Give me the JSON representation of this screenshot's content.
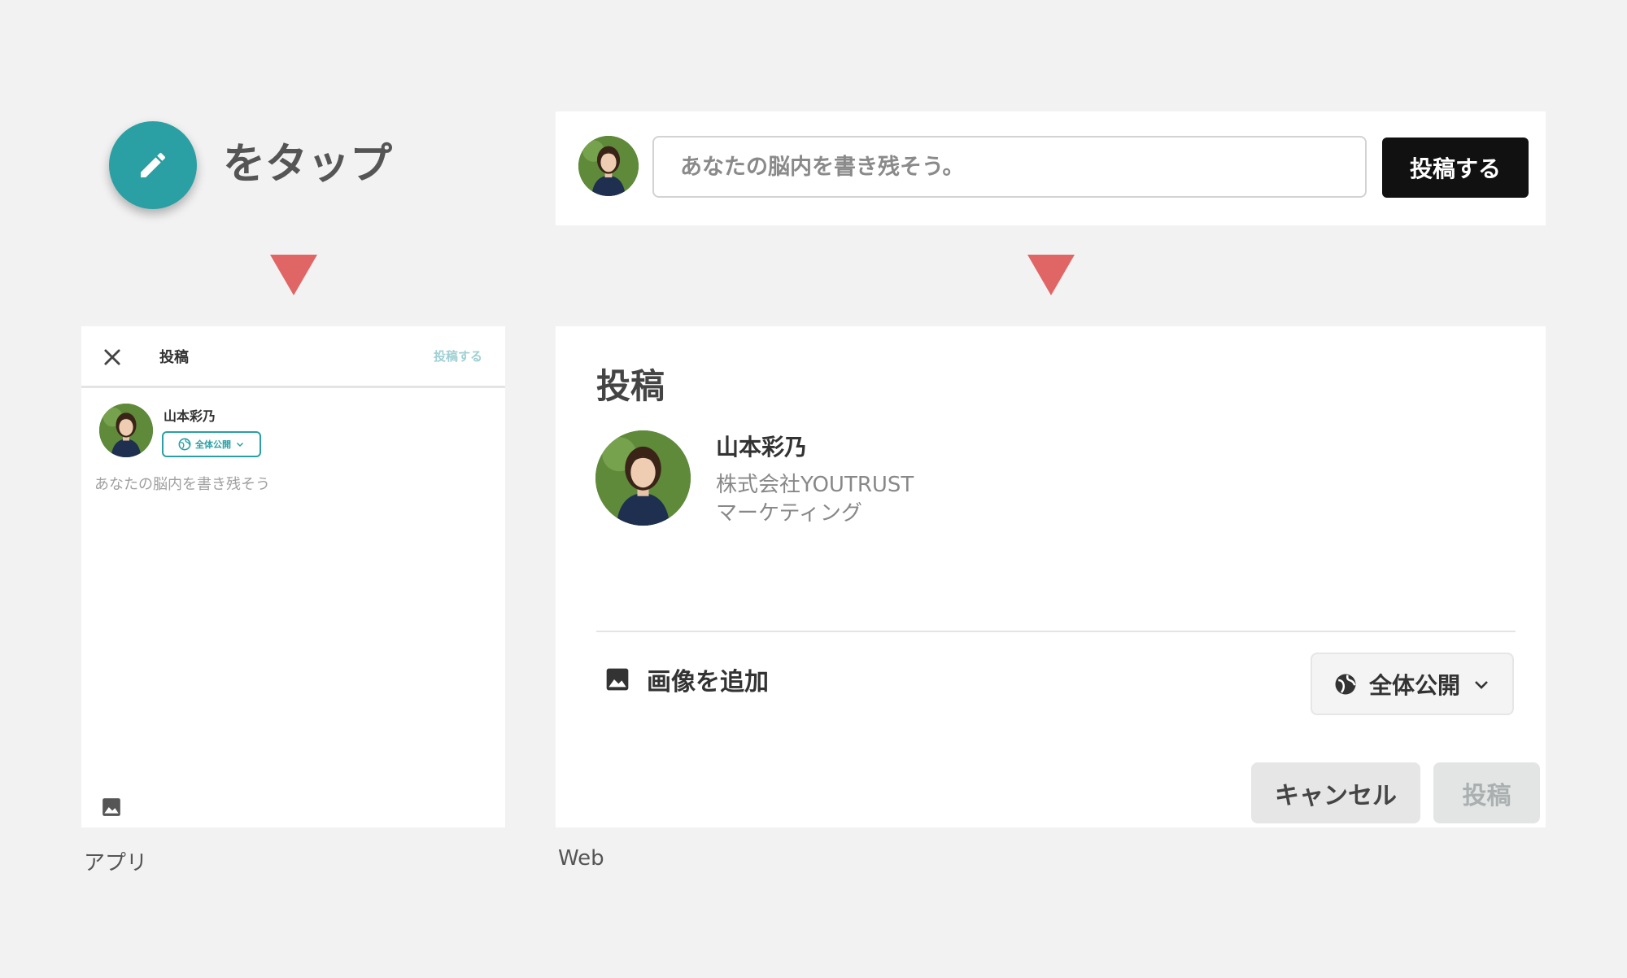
{
  "instruction": {
    "tap_label": "をタップ",
    "fab_icon": "pencil-icon"
  },
  "web_bar": {
    "input_placeholder": "あなたの脳内を書き残そう。",
    "post_button": "投稿する"
  },
  "app": {
    "caption": "アプリ",
    "header": {
      "close_icon": "close-icon",
      "title": "投稿",
      "post_link": "投稿する"
    },
    "user_name": "山本彩乃",
    "visibility": "全体公開",
    "placeholder": "あなたの脳内を書き残そう",
    "image_icon": "image-icon"
  },
  "web": {
    "caption": "Web",
    "dialog": {
      "title": "投稿",
      "user_name": "山本彩乃",
      "company": "株式会社YOUTRUST",
      "role": "マーケティング",
      "add_image": "画像を追加",
      "visibility": "全体公開",
      "cancel": "キャンセル",
      "submit": "投稿"
    }
  },
  "colors": {
    "fab": "#2aa0a4",
    "arrow": "#e06666",
    "primary_button": "#111111",
    "accent_teal": "#2aa0a4"
  }
}
